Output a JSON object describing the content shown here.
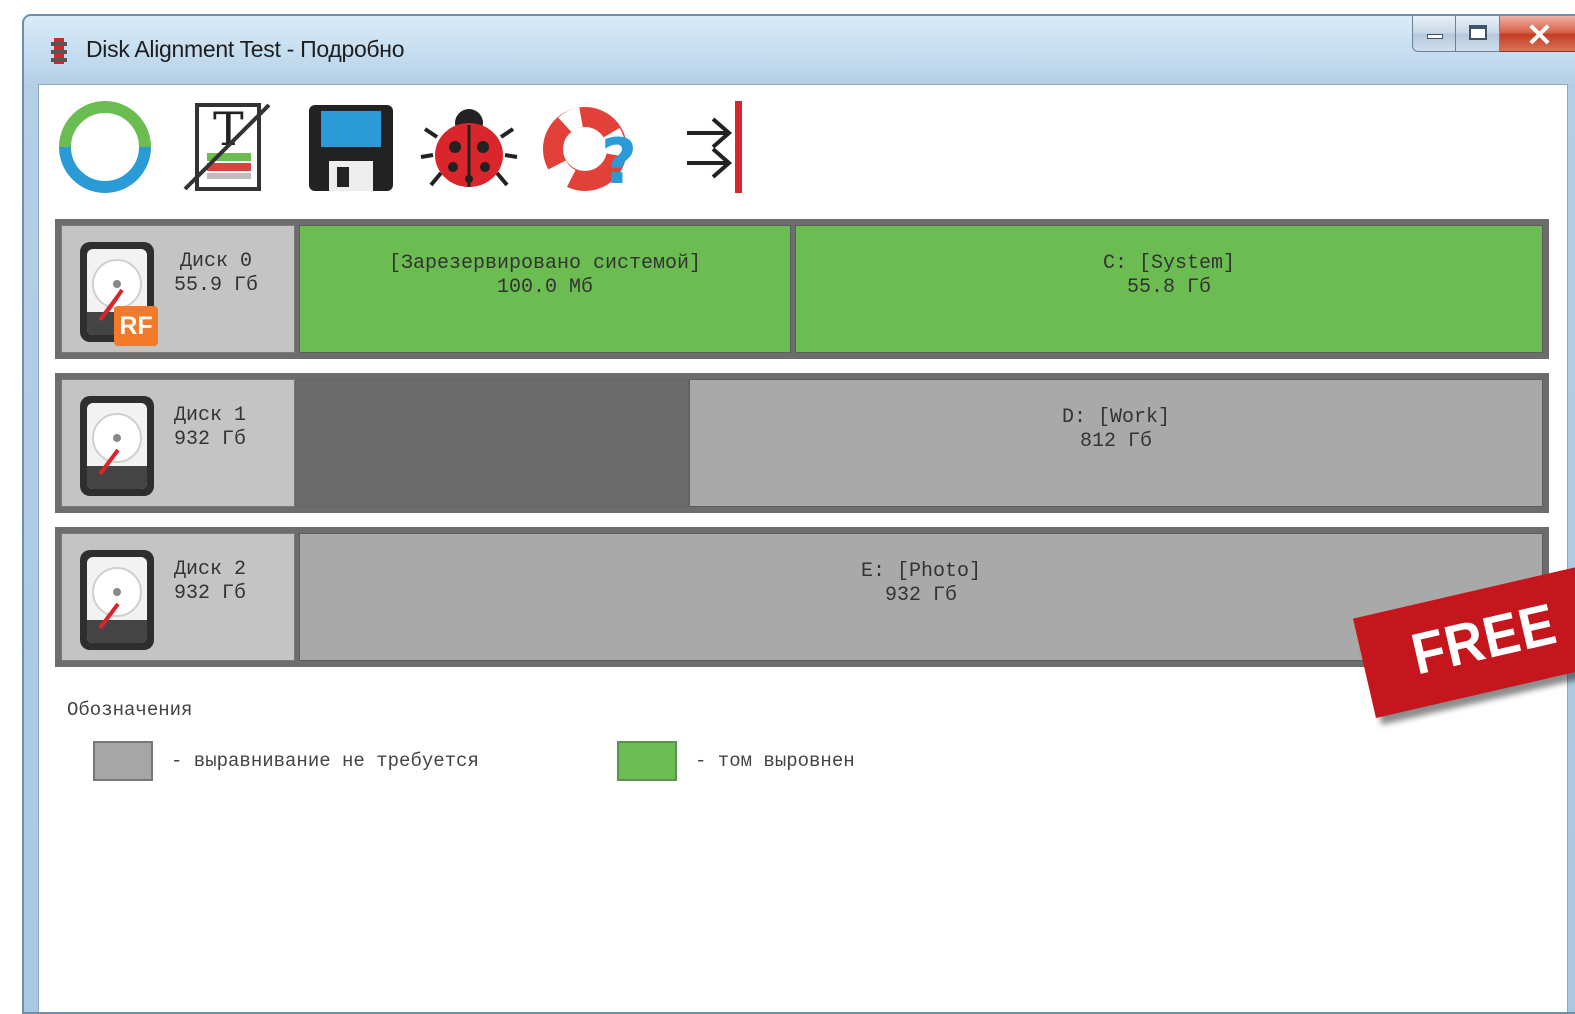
{
  "window": {
    "title": "Disk Alignment Test - Подробно",
    "buttons": [
      "minimize",
      "maximize",
      "close"
    ]
  },
  "toolbar": {
    "items": [
      {
        "name": "refresh",
        "icon": "refresh-icon"
      },
      {
        "name": "text-report",
        "icon": "text-report-icon"
      },
      {
        "name": "save",
        "icon": "floppy-disk-icon"
      },
      {
        "name": "debug",
        "icon": "ladybug-icon"
      },
      {
        "name": "help",
        "icon": "lifebuoy-help-icon"
      },
      {
        "name": "exit",
        "icon": "exit-arrows-icon"
      }
    ]
  },
  "disks": [
    {
      "name": "Диск 0",
      "size": "55.9 Гб",
      "badge": "RF",
      "partitions": [
        {
          "label": "[Зарезервировано системой]",
          "size": "100.0 Мб",
          "status": "aligned"
        },
        {
          "label": "C: [System]",
          "size": "55.8 Гб",
          "status": "aligned"
        }
      ]
    },
    {
      "name": "Диск 1",
      "size": "932 Гб",
      "partitions": [
        {
          "label": "",
          "size": "",
          "status": "unallocated"
        },
        {
          "label": "D: [Work]",
          "size": "812 Гб",
          "status": "not-required"
        }
      ]
    },
    {
      "name": "Диск 2",
      "size": "932 Гб",
      "partitions": [
        {
          "label": "E: [Photo]",
          "size": "932 Гб",
          "status": "not-required"
        }
      ]
    }
  ],
  "legend": {
    "title": "Обозначения",
    "items": [
      {
        "text": "- выравнивание не требуется",
        "color": "#a6a6a6"
      },
      {
        "text": "- том выровнен",
        "color": "#6bbd51"
      }
    ]
  },
  "overlay_badge": "FREE",
  "colors": {
    "aligned": "#6bbd51",
    "not_required": "#a9a9a9",
    "unallocated": "#6b6b6b",
    "rf_badge": "#f27a28",
    "free_badge": "#c4161c"
  }
}
